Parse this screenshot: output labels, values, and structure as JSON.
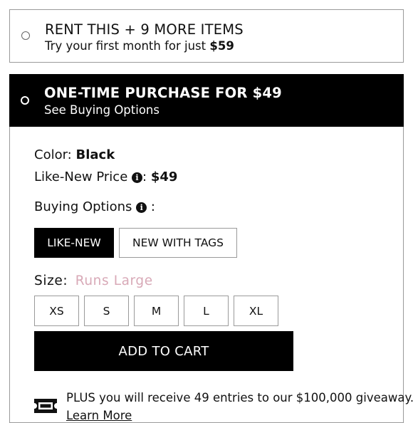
{
  "rent_option": {
    "title": "RENT THIS + 9 MORE ITEMS",
    "subtitle_prefix": "Try your first month for just",
    "subtitle_price": "$59"
  },
  "purchase_option": {
    "title": "ONE-TIME PURCHASE FOR $49",
    "subtitle": "See Buying Options"
  },
  "details": {
    "color_label": "Color:",
    "color_value": "Black",
    "price_label": "Like-New Price",
    "price_sep": ":",
    "price_value": "$49",
    "buying_label": "Buying Options",
    "buying_sep": ":"
  },
  "buying_options": [
    {
      "label": "LIKE-NEW",
      "selected": true
    },
    {
      "label": "NEW WITH TAGS",
      "selected": false
    }
  ],
  "size": {
    "label": "Size:",
    "note": "Runs Large",
    "note_color": "#d8a9b7",
    "options": [
      "XS",
      "S",
      "M",
      "L",
      "XL"
    ]
  },
  "cart": {
    "label": "ADD TO CART"
  },
  "promo": {
    "text": "PLUS you will receive 49 entries to our $100,000 giveaway.",
    "link": "Learn More"
  },
  "icons": {
    "info": "info-circle-icon",
    "ticket": "ticket-icon",
    "radio": "radio-button"
  }
}
